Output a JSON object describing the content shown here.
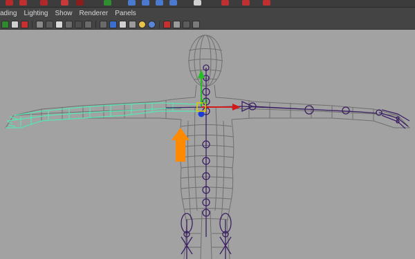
{
  "menubar": {
    "items": [
      "ading",
      "Lighting",
      "Show",
      "Renderer",
      "Panels"
    ]
  },
  "toolbar": {
    "icons": [
      "camera-icon",
      "grid-icon",
      "select-camera-icon",
      "bookmark-icon",
      "wireframe-icon",
      "smooth-shade-icon",
      "textured-icon",
      "lights-icon",
      "shadows-icon",
      "wireframe-on-shaded-icon",
      "xray-icon",
      "xray-joints-icon",
      "backface-icon",
      "ambient-occlusion-icon",
      "motion-blur-icon",
      "antialias-icon",
      "isolate-select-icon",
      "cube-view-icon",
      "scene-icon",
      "share-icon"
    ]
  },
  "viewport": {
    "description_items": [
      "character-wireframe",
      "skeleton-joints",
      "move-manipulator",
      "orange-arrow"
    ],
    "colors": {
      "background": "#a2a2a2",
      "mesh": "#6e6e6e",
      "skeleton": "#3b1e63",
      "highlight": "#55e8b2",
      "arrow": "#ff8a00",
      "axis_x": "#d11b1b",
      "axis_y": "#20c020",
      "axis_z": "#1b3cd8",
      "center_handle": "#e0d000"
    }
  }
}
